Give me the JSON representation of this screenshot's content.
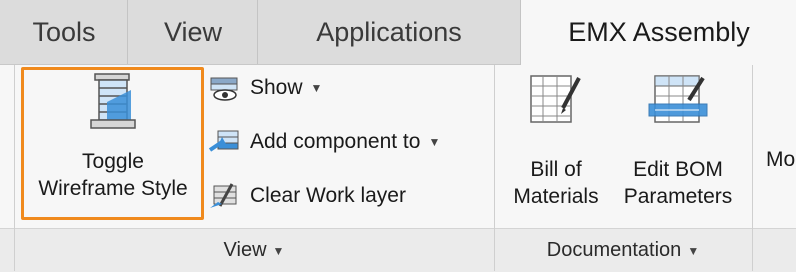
{
  "tabs": [
    {
      "label": "Tools"
    },
    {
      "label": "View"
    },
    {
      "label": "Applications"
    },
    {
      "label": "EMX Assembly",
      "active": true
    }
  ],
  "groups": {
    "view": {
      "label": "View",
      "toggle_wireframe": {
        "line1": "Toggle",
        "line2": "Wireframe Style",
        "icon": "wireframe-icon"
      },
      "show": {
        "label": "Show",
        "icon": "eye-icon"
      },
      "add_component": {
        "label": "Add component to",
        "icon": "add-component-icon"
      },
      "clear_work_layer": {
        "label": "Clear Work layer",
        "icon": "clear-layer-icon"
      }
    },
    "documentation": {
      "label": "Documentation",
      "bill_of_materials": {
        "line1": "Bill of",
        "line2": "Materials",
        "icon": "table-edit-icon"
      },
      "edit_bom": {
        "line1": "Edit BOM",
        "line2": "Parameters",
        "icon": "table-params-icon"
      }
    },
    "next": {
      "label_partial": "Mo"
    }
  },
  "colors": {
    "highlight": "#f08a1d",
    "icon_blue": "#3a8fd8"
  }
}
